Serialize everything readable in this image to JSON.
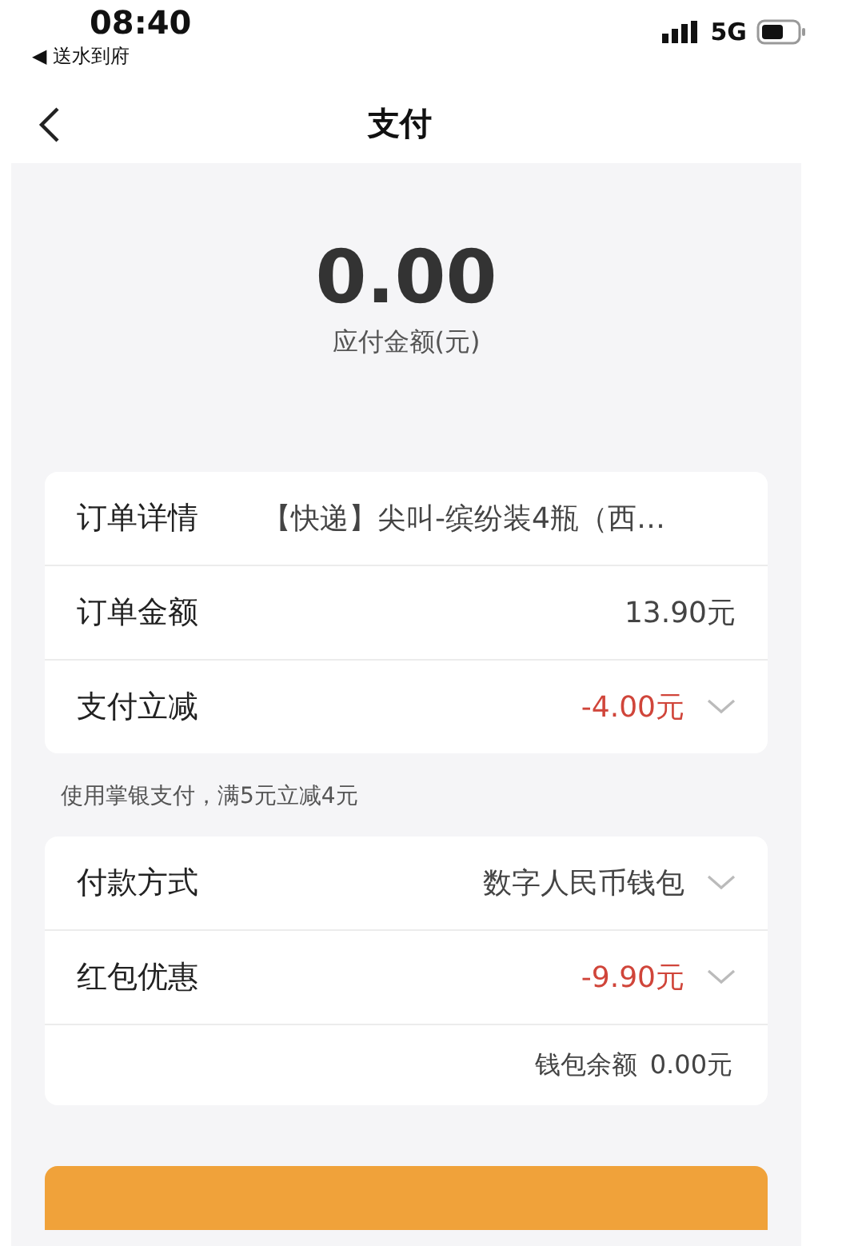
{
  "status_bar": {
    "time": "08:40",
    "back_app": "◀ 送水到府",
    "network": "5G"
  },
  "nav": {
    "title": "支付"
  },
  "amount": {
    "value": "0.00",
    "label": "应付金额(元)"
  },
  "order_card": [
    {
      "label": "订单详情",
      "value": "【快递】尖叫-缤纷装4瓶（西…",
      "kind": "plain"
    },
    {
      "label": "订单金额",
      "value": "13.90元",
      "kind": "plain"
    },
    {
      "label": "支付立减",
      "value": "-4.00元",
      "kind": "discount"
    }
  ],
  "promo_note": "使用掌银支付，满5元立减4元",
  "payment_card": [
    {
      "label": "付款方式",
      "value": "数字人民币钱包",
      "kind": "select"
    },
    {
      "label": "红包优惠",
      "value": "-9.90元",
      "kind": "discount"
    }
  ],
  "wallet_balance": {
    "label": "钱包余额",
    "value": "0.00元"
  }
}
